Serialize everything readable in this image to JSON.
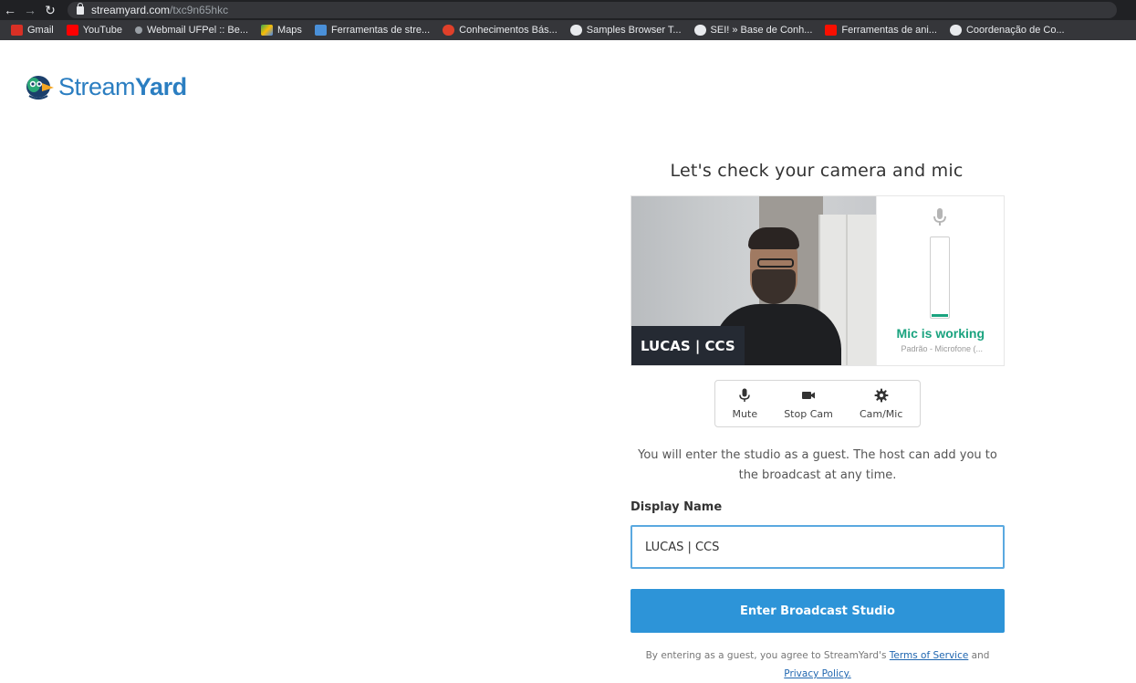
{
  "browser": {
    "url_host": "streamyard.com",
    "url_path": "/txc9n65hkc",
    "bookmarks": [
      {
        "label": "Gmail",
        "icon": "gmail-icon",
        "color": "#d93025"
      },
      {
        "label": "YouTube",
        "icon": "youtube-icon",
        "color": "#ff0000"
      },
      {
        "label": "Webmail UFPel :: Be...",
        "icon": "webmail-icon",
        "color": "#9aa0a6"
      },
      {
        "label": "Maps",
        "icon": "maps-icon",
        "color": "#34a853"
      },
      {
        "label": "Ferramentas de stre...",
        "icon": "bookmark-favicon",
        "color": "#4a90d9"
      },
      {
        "label": "Conhecimentos Bás...",
        "icon": "bookmark-favicon",
        "color": "#e0402a"
      },
      {
        "label": "Samples Browser T...",
        "icon": "globe-icon",
        "color": "#e8eaed"
      },
      {
        "label": "SEI! » Base de Conh...",
        "icon": "globe-icon",
        "color": "#e8eaed"
      },
      {
        "label": "Ferramentas de ani...",
        "icon": "adobe-icon",
        "color": "#fa0f00"
      },
      {
        "label": "Coordenação de Co...",
        "icon": "globe-icon",
        "color": "#e8eaed"
      }
    ]
  },
  "logo": {
    "text_light": "Stream",
    "text_bold": "Yard"
  },
  "main": {
    "heading": "Let's check your camera and mic",
    "name_tag": "LUCAS | CCS",
    "mic_status": "Mic is working",
    "mic_device": "Padrão - Microfone (...",
    "controls": {
      "mute": "Mute",
      "stop_cam": "Stop Cam",
      "cam_mic": "Cam/Mic"
    },
    "info_text": "You will enter the studio as a guest. The host can add you to the broadcast at any time.",
    "display_name_label": "Display Name",
    "display_name_value": "LUCAS | CCS",
    "enter_button": "Enter Broadcast Studio",
    "terms_prefix": "By entering as a guest, you agree to StreamYard's ",
    "terms_link": "Terms of Service",
    "terms_and": " and ",
    "privacy_link": "Privacy Policy."
  },
  "colors": {
    "accent": "#2d94d8",
    "mic_ok": "#1aa37f",
    "brand": "#2b7ec1"
  }
}
